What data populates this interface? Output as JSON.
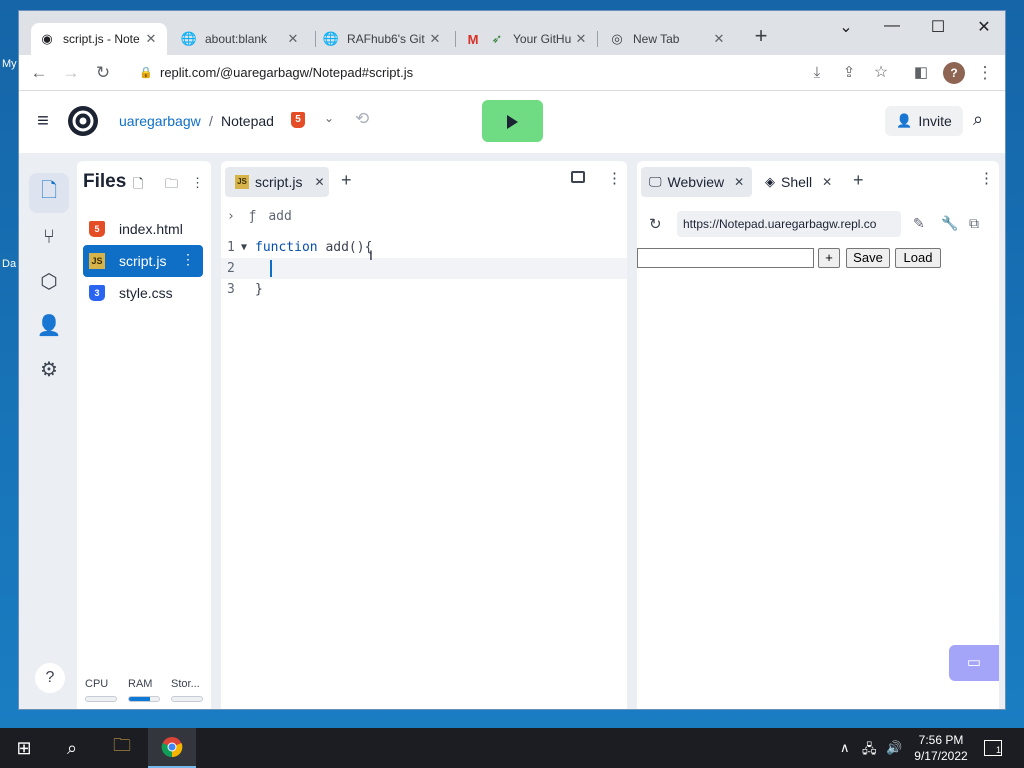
{
  "desktop": {
    "fragments": [
      "My",
      "Da"
    ]
  },
  "browser": {
    "tabs": [
      {
        "title": "script.js - Note",
        "icon": "replit-icon",
        "active": true
      },
      {
        "title": "about:blank",
        "icon": "globe-icon"
      },
      {
        "title": "RAFhub6's Git",
        "icon": "globe-icon"
      },
      {
        "title": "Your GitHu",
        "icon": "gmail-rocket-icon"
      },
      {
        "title": "New Tab",
        "icon": "chrome-icon"
      }
    ],
    "new_tab_symbol": "+",
    "url": "replit.com/@uaregarbagw/Notepad#script.js",
    "profile_initial": "?"
  },
  "replit": {
    "owner": "uaregarbagw",
    "separator": "/",
    "project": "Notepad",
    "project_lang_badge": "5",
    "invite_label": "Invite",
    "files_title": "Files",
    "files": [
      {
        "name": "index.html",
        "type": "html"
      },
      {
        "name": "script.js",
        "type": "js",
        "active": true
      },
      {
        "name": "style.css",
        "type": "css"
      }
    ],
    "resources": [
      {
        "label": "CPU",
        "usage_percent": 0
      },
      {
        "label": "RAM",
        "usage_percent": 70
      },
      {
        "label": "Stor...",
        "usage_percent": 0
      }
    ],
    "help_label": "?",
    "editor": {
      "tab_label": "script.js",
      "js_badge": "JS",
      "breadcrumb_symbol": "ƒ",
      "breadcrumb": "add",
      "lines": [
        {
          "num": "1",
          "keyword": "function",
          "rest": " add(){"
        },
        {
          "num": "2",
          "keyword": "",
          "rest": ""
        },
        {
          "num": "3",
          "keyword": "",
          "rest": "}"
        }
      ]
    },
    "panel": {
      "tabs": [
        {
          "label": "Webview",
          "active": true
        },
        {
          "label": "Shell"
        }
      ],
      "webview_url": "https://Notepad.uaregarbagw.repl.co",
      "page_buttons": {
        "plus": "+",
        "save": "Save",
        "load": "Load"
      }
    }
  },
  "taskbar": {
    "time": "7:56 PM",
    "date": "9/17/2022",
    "notification_count": "1"
  }
}
